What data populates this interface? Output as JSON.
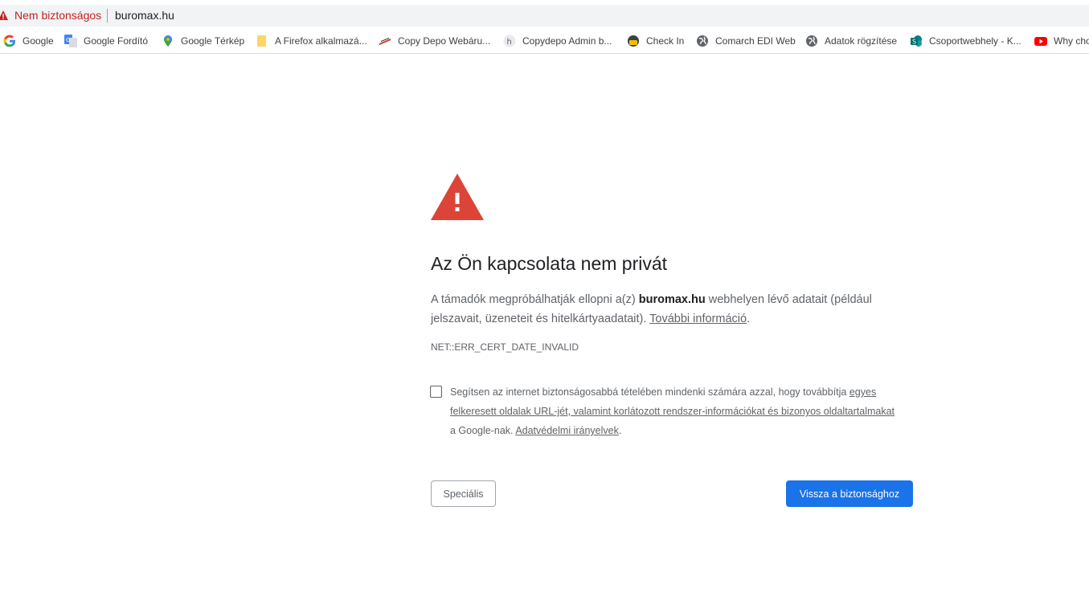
{
  "omnibox": {
    "security_label": "Nem biztonságos",
    "url": "buromax.hu"
  },
  "bookmarks": [
    {
      "label": "Google",
      "icon": "google-icon"
    },
    {
      "label": "Google Fordító",
      "icon": "google-translate-icon"
    },
    {
      "label": "Google Térkép",
      "icon": "google-maps-icon"
    },
    {
      "label": "A Firefox alkalmazá...",
      "icon": "folder-icon"
    },
    {
      "label": "Copy Depo Webáru...",
      "icon": "copydepo-icon"
    },
    {
      "label": "Copydepo Admin b...",
      "icon": "copydepo-admin-icon"
    },
    {
      "label": "Check In",
      "icon": "check-in-icon"
    },
    {
      "label": "Comarch EDI Web",
      "icon": "globe-icon"
    },
    {
      "label": "Adatok rögzítése",
      "icon": "globe-icon"
    },
    {
      "label": "Csoportwebhely - K...",
      "icon": "sharepoint-icon"
    },
    {
      "label": "Why cho",
      "icon": "youtube-icon"
    }
  ],
  "interstitial": {
    "heading": "Az Ön kapcsolata nem privát",
    "para_part1": "A támadók megpróbálhatják ellopni a(z) ",
    "para_domain": "buromax.hu",
    "para_part2": " webhelyen lévő adatait (például jelszavait, üzeneteit és hitelkártyaadatait). ",
    "more_info_link": "További információ",
    "para_end": ".",
    "error_code": "NET::ERR_CERT_DATE_INVALID",
    "checkbox_text1": "Segítsen az internet biztonságosabbá tételében mindenki számára azzal, hogy továbbítja ",
    "checkbox_link1": "egyes felkeresett oldalak URL-jét, valamint korlátozott rendszer-információkat és bizonyos oldaltartalmakat",
    "checkbox_text2": " a Google-nak. ",
    "checkbox_link2": "Adatvédelmi irányelvek",
    "checkbox_end": ".",
    "advanced_button": "Speciális",
    "back_button": "Vissza a biztonsághoz"
  },
  "colors": {
    "warning_red": "#db4437",
    "accent_blue": "#1a73e8",
    "insecure_text": "#c5221f"
  }
}
